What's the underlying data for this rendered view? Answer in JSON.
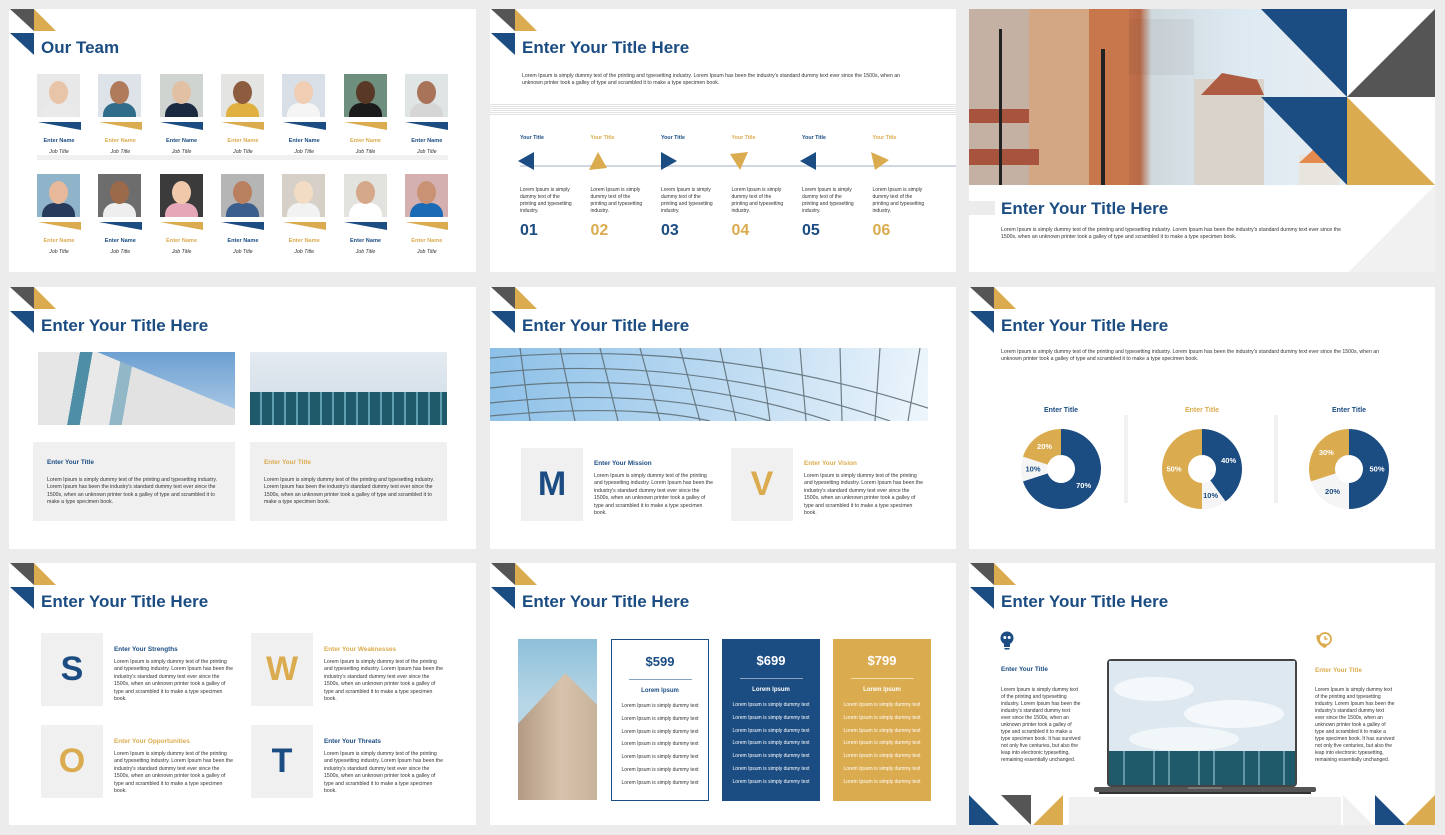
{
  "colors": {
    "blue": "#1b4c82",
    "gold": "#dbab4f",
    "dark": "#555555",
    "grey": "#f0f0f0",
    "canvas": "#ececec"
  },
  "slides": {
    "team": {
      "title": "Our Team",
      "members": [
        {
          "name": "Enter Name",
          "job": "Job Title",
          "color": "blue"
        },
        {
          "name": "Enter Name",
          "job": "Job Title",
          "color": "gold"
        },
        {
          "name": "Enter Name",
          "job": "Job Title",
          "color": "blue"
        },
        {
          "name": "Enter Name",
          "job": "Job Title",
          "color": "gold"
        },
        {
          "name": "Enter Name",
          "job": "Job Title",
          "color": "blue"
        },
        {
          "name": "Enter Name",
          "job": "Job Title",
          "color": "gold"
        },
        {
          "name": "Enter Name",
          "job": "Job Title",
          "color": "blue"
        },
        {
          "name": "Enter Name",
          "job": "Job Title",
          "color": "gold"
        },
        {
          "name": "Enter Name",
          "job": "Job Title",
          "color": "blue"
        },
        {
          "name": "Enter Name",
          "job": "Job Title",
          "color": "gold"
        },
        {
          "name": "Enter Name",
          "job": "Job Title",
          "color": "blue"
        },
        {
          "name": "Enter Name",
          "job": "Job Title",
          "color": "gold"
        },
        {
          "name": "Enter Name",
          "job": "Job Title",
          "color": "blue"
        },
        {
          "name": "Enter Name",
          "job": "Job Title",
          "color": "gold"
        }
      ]
    },
    "timeline": {
      "title": "Enter Your Title Here",
      "intro": "Lorem Ipsum is simply dummy text of the printing and typesetting industry. Lorem Ipsum has been the industry's standard dummy text ever since the 1500s, when an unknown printer took a galley of type and scrambled it to make a type specimen book.",
      "steps": [
        {
          "title": "Your Title",
          "text": "Lorem Ipsum is simply dummy text of the printing and typesetting industry.",
          "number": "01",
          "color": "blue",
          "arrow": "left"
        },
        {
          "title": "Your Title",
          "text": "Lorem Ipsum is simply dummy text of the printing and typesetting industry.",
          "number": "02",
          "color": "gold",
          "arrow": "up"
        },
        {
          "title": "Your Title",
          "text": "Lorem Ipsum is simply dummy text of the printing and typesetting industry.",
          "number": "03",
          "color": "blue",
          "arrow": "right"
        },
        {
          "title": "Your Title",
          "text": "Lorem Ipsum is simply dummy text of the printing and typesetting industry.",
          "number": "04",
          "color": "gold",
          "arrow": "down"
        },
        {
          "title": "Your Title",
          "text": "Lorem Ipsum is simply dummy text of the printing and typesetting industry.",
          "number": "05",
          "color": "blue",
          "arrow": "left"
        },
        {
          "title": "Your Title",
          "text": "Lorem Ipsum is simply dummy text of the printing and typesetting industry.",
          "number": "06",
          "color": "gold",
          "arrow": "down-right"
        }
      ]
    },
    "cover": {
      "title": "Enter Your Title Here",
      "text": "Lorem Ipsum is simply dummy text of the printing and typesetting industry. Lorem Ipsum has been the industry's standard dummy text ever since the 1500s, when an unknown printer took a galley of type and scrambled it to make a type specimen book."
    },
    "two_cards": {
      "title": "Enter Your Title Here",
      "cards": [
        {
          "title": "Enter Your Title",
          "text": "Lorem Ipsum is simply dummy text of the printing and typesetting industry. Lorem Ipsum has been the industry's standard dummy text ever since the 1500s, when an unknown printer took a galley of type and scrambled it to make a type specimen book.",
          "color": "blue"
        },
        {
          "title": "Enter Your Title",
          "text": "Lorem Ipsum is simply dummy text of the printing and typesetting industry. Lorem Ipsum has been the industry's standard dummy text ever since the 1500s, when an unknown printer took a galley of type and scrambled it to make a type specimen book.",
          "color": "gold"
        }
      ]
    },
    "mission_vision": {
      "title": "Enter Your Title Here",
      "items": [
        {
          "letter": "M",
          "title": "Enter Your Mission",
          "text": "Lorem Ipsum is simply dummy text of the printing and typesetting industry. Lorem Ipsum has been the industry's standard dummy text ever since the 1500s, when an unknown printer took a galley of type and scrambled it to make a type specimen book.",
          "color": "blue"
        },
        {
          "letter": "V",
          "title": "Enter Your Vision",
          "text": "Lorem Ipsum is simply dummy text of the printing and typesetting industry. Lorem Ipsum has been the industry's standard dummy text ever since the 1500s, when an unknown printer took a galley of type and scrambled it to make a type specimen book.",
          "color": "gold"
        }
      ]
    },
    "donuts": {
      "title": "Enter Your Title Here",
      "intro": "Lorem Ipsum is simply dummy text of the printing and typesetting industry. Lorem Ipsum has been the industry's standard dummy text ever since the 1500s, when an unknown printer took a galley of type and scrambled it to make a type specimen book."
    },
    "swot": {
      "title": "Enter Your Title Here",
      "items": [
        {
          "letter": "S",
          "title": "Enter Your Strengths",
          "text": "Lorem Ipsum is simply dummy text of the printing and typesetting industry. Lorem Ipsum has been the industry's standard dummy text ever since the 1500s, when an unknown printer took a galley of type and scrambled it to make a type specimen book.",
          "color": "blue"
        },
        {
          "letter": "W",
          "title": "Enter Your Weaknesses",
          "text": "Lorem Ipsum is simply dummy text of the printing and typesetting industry. Lorem Ipsum has been the industry's standard dummy text ever since the 1500s, when an unknown printer took a galley of type and scrambled it to make a type specimen book.",
          "color": "gold"
        },
        {
          "letter": "O",
          "title": "Enter Your Opportunities",
          "text": "Lorem Ipsum is simply dummy text of the printing and typesetting industry. Lorem Ipsum has been the industry's standard dummy text ever since the 1500s, when an unknown printer took a galley of type and scrambled it to make a type specimen book.",
          "color": "gold"
        },
        {
          "letter": "T",
          "title": "Enter Your Threats",
          "text": "Lorem Ipsum is simply dummy text of the printing and typesetting industry. Lorem Ipsum has been the industry's standard dummy text ever since the 1500s, when an unknown printer took a galley of type and scrambled it to make a type specimen book.",
          "color": "blue"
        }
      ]
    },
    "pricing": {
      "title": "Enter Your Title Here",
      "plans": [
        {
          "price": "$599",
          "heading": "Lorem Ipsum",
          "style": "outline",
          "rows": [
            "Lorem Ipsum is simply dummy text",
            "Lorem Ipsum is simply dummy text",
            "Lorem Ipsum is simply dummy text",
            "Lorem Ipsum is simply dummy text",
            "Lorem Ipsum is simply dummy text",
            "Lorem Ipsum is simply dummy text",
            "Lorem Ipsum is simply dummy text"
          ]
        },
        {
          "price": "$699",
          "heading": "Lorem Ipsum",
          "style": "blue",
          "rows": [
            "Lorem Ipsum is simply dummy text",
            "Lorem Ipsum is simply dummy text",
            "Lorem Ipsum is simply dummy text",
            "Lorem Ipsum is simply dummy text",
            "Lorem Ipsum is simply dummy text",
            "Lorem Ipsum is simply dummy text",
            "Lorem Ipsum is simply dummy text"
          ]
        },
        {
          "price": "$799",
          "heading": "Lorem Ipsum",
          "style": "gold",
          "rows": [
            "Lorem Ipsum is simply dummy text",
            "Lorem Ipsum is simply dummy text",
            "Lorem Ipsum is simply dummy text",
            "Lorem Ipsum is simply dummy text",
            "Lorem Ipsum is simply dummy text",
            "Lorem Ipsum is simply dummy text",
            "Lorem Ipsum is simply dummy text"
          ]
        }
      ]
    },
    "laptop": {
      "title": "Enter Your Title Here",
      "left": {
        "icon": "lightbulb-icon",
        "title": "Enter Your Title",
        "text": "Lorem Ipsum is simply dummy text of the printing and typesetting industry. Lorem Ipsum has been the industry's standard dummy text ever since the 1500s, when an unknown printer took a galley of type and scrambled it to make a type specimen book. It has survived not only five centuries, but also the leap into electronic typesetting, remaining essentially unchanged."
      },
      "right": {
        "icon": "phone-clock-icon",
        "title": "Enter Your Title",
        "text": "Lorem Ipsum is simply dummy text of the printing and typesetting industry. Lorem Ipsum has been the industry's standard dummy text ever since the 1500s, when an unknown printer took a galley of type and scrambled it to make a type specimen book. It has survived not only five centuries, but also the leap into electronic typesetting, remaining essentially unchanged."
      }
    }
  },
  "chart_data": [
    {
      "type": "pie",
      "variant": "donut",
      "title": "Enter Title",
      "labels": [
        "Blue",
        "White",
        "Gold"
      ],
      "values": [
        70,
        10,
        20
      ],
      "value_labels": [
        "70%",
        "10%",
        "20%"
      ],
      "colors": [
        "#1b4c82",
        "#f5f5f5",
        "#dbab4f"
      ]
    },
    {
      "type": "pie",
      "variant": "donut",
      "title": "Enter Title",
      "labels": [
        "Blue",
        "White",
        "Gold"
      ],
      "values": [
        40,
        10,
        50
      ],
      "value_labels": [
        "40%",
        "10%",
        "50%"
      ],
      "colors": [
        "#1b4c82",
        "#f5f5f5",
        "#dbab4f"
      ]
    },
    {
      "type": "pie",
      "variant": "donut",
      "title": "Enter Title",
      "labels": [
        "Blue",
        "White",
        "Gold"
      ],
      "values": [
        50,
        20,
        30
      ],
      "value_labels": [
        "50%",
        "20%",
        "30%"
      ],
      "colors": [
        "#1b4c82",
        "#f5f5f5",
        "#dbab4f"
      ]
    }
  ]
}
